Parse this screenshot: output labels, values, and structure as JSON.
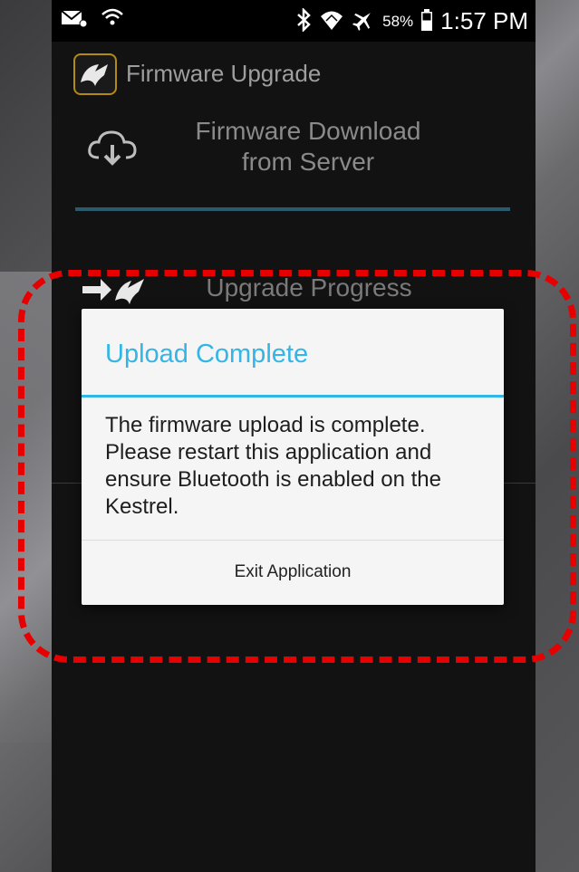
{
  "status_bar": {
    "battery_percent": "58%",
    "time": "1:57 PM",
    "icons": [
      "voicemail-icon",
      "wifi-call-icon",
      "bluetooth-icon",
      "wifi-icon",
      "airplane-icon",
      "battery-icon"
    ]
  },
  "app": {
    "title": "Firmware Upgrade",
    "logo_icon": "kestrel-bird-logo-icon"
  },
  "steps": [
    {
      "title": "Firmware Download from Server",
      "icon": "cloud-download-icon",
      "progress": 1.0,
      "accent": "#2a5b6c"
    },
    {
      "title": "Upgrade Progress",
      "icon": "arrow-bird-icon"
    }
  ],
  "dialog": {
    "title": "Upload Complete",
    "message": "The firmware upload is complete. Please restart this application and ensure Bluetooth is enabled on the Kestrel.",
    "button_label": "Exit Application",
    "accent_color": "#33b5e5"
  },
  "annotation": {
    "color": "#e60000",
    "style": "dashed-rounded-rectangle"
  }
}
